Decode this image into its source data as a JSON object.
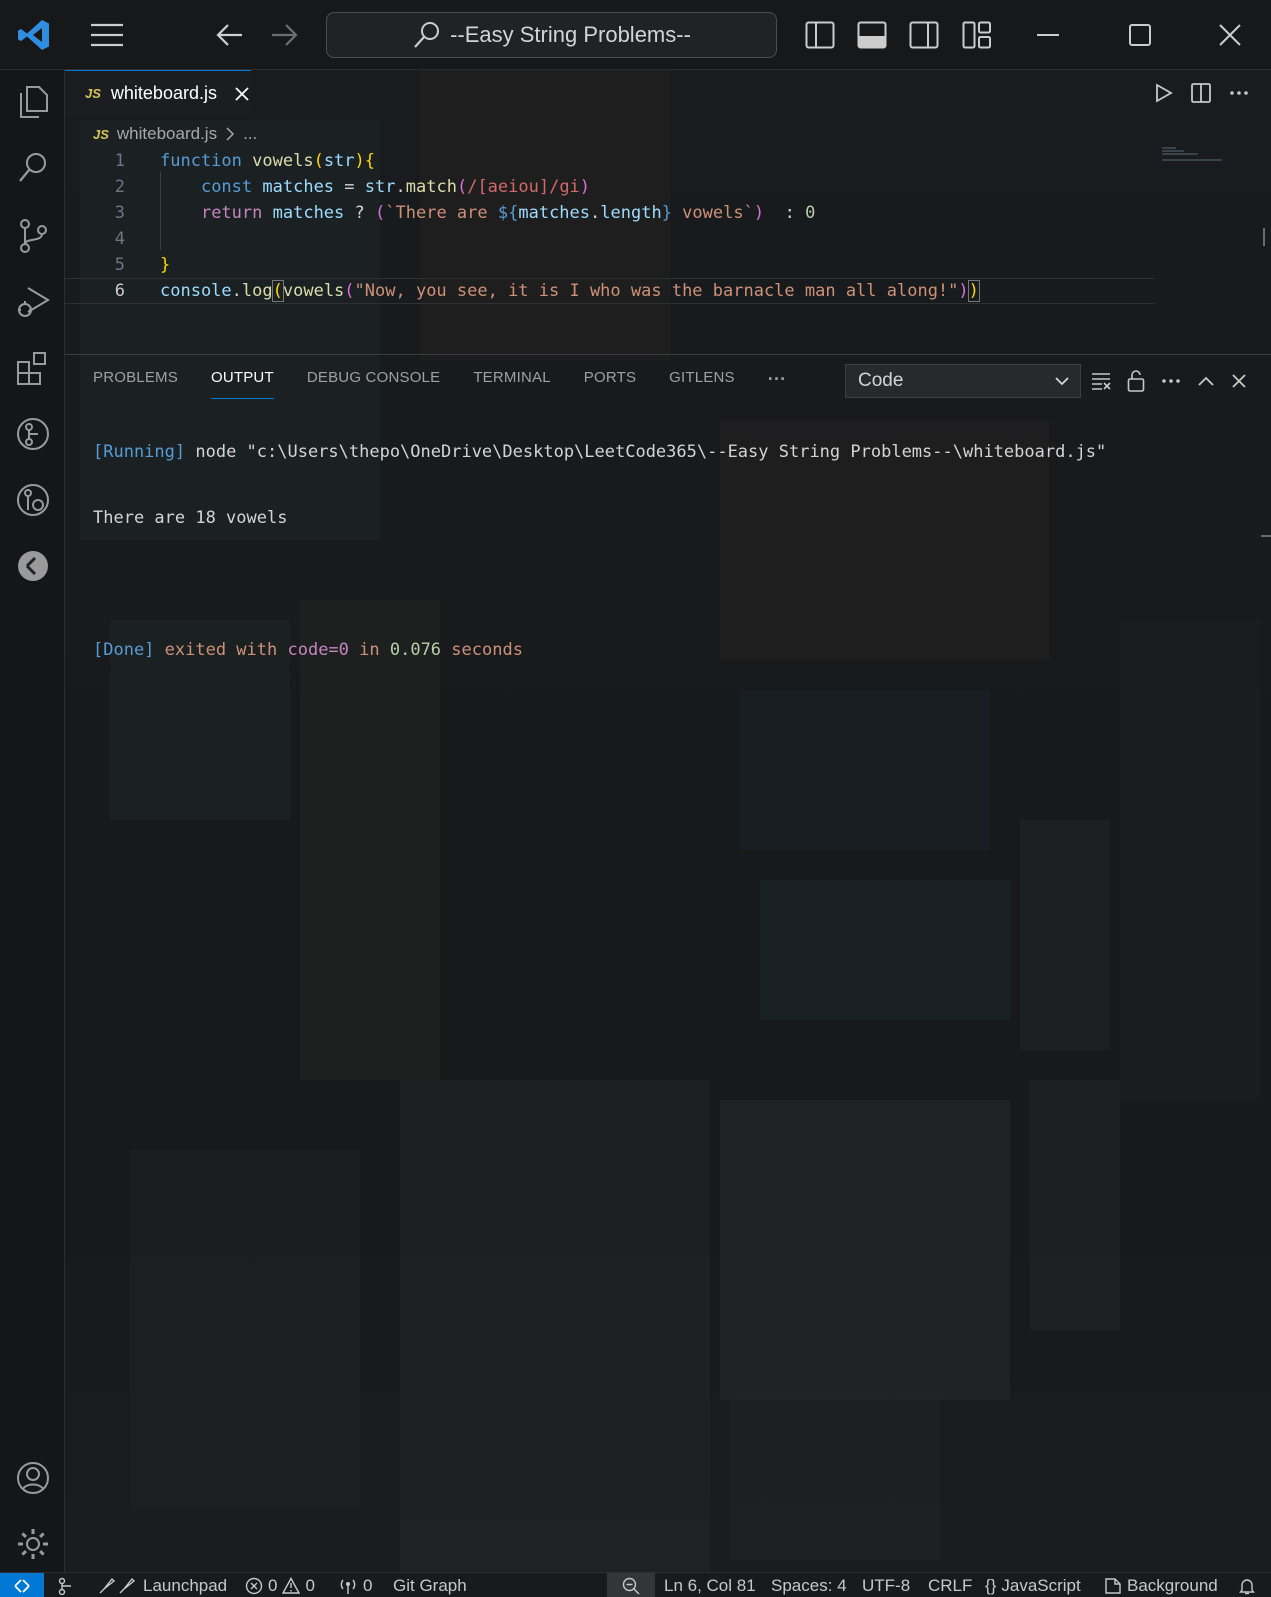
{
  "window": {
    "search_text": "--Easy String Problems--"
  },
  "tab": {
    "badge": "JS",
    "filename": "whiteboard.js"
  },
  "breadcrumb": {
    "badge": "JS",
    "file": "whiteboard.js",
    "more": "..."
  },
  "editor": {
    "line_numbers": [
      "1",
      "2",
      "3",
      "4",
      "5",
      "6"
    ],
    "current_line": 6,
    "lines": [
      "function vowels(str){",
      "    const matches = str.match(/[aeiou]/gi)",
      "    return matches ? (`There are ${matches.length} vowels`)  : 0",
      "",
      "}",
      "console.log(vowels(\"Now, you see, it is I who was the barnacle man all along!\"))"
    ]
  },
  "panel": {
    "tabs": [
      "PROBLEMS",
      "OUTPUT",
      "DEBUG CONSOLE",
      "TERMINAL",
      "PORTS",
      "GITLENS"
    ],
    "more": "···",
    "active_tab": "OUTPUT",
    "channel": "Code",
    "output": {
      "running_tag": "[Running]",
      "running_cmd": " node \"c:\\Users\\thepo\\OneDrive\\Desktop\\LeetCode365\\--Easy String Problems--\\whiteboard.js\"",
      "result": "There are 18 vowels",
      "done_tag": "[Done]",
      "done_exited": " exited with ",
      "done_code": "code=0",
      "done_in": " in ",
      "done_time": "0.076",
      "done_seconds": " seconds"
    }
  },
  "status": {
    "launchpad": "Launchpad",
    "errors": "0",
    "warnings": "0",
    "ports": "0",
    "git_graph": "Git Graph",
    "position": "Ln 6, Col 81",
    "spaces": "Spaces: 4",
    "encoding": "UTF-8",
    "eol": "CRLF",
    "language_braces": "{}",
    "language": "JavaScript",
    "background": "Background"
  },
  "colors": {
    "accent": "#0078d4",
    "keyword": "#569cd6",
    "function": "#dcdcaa",
    "variable": "#9cdcfe",
    "string": "#ce9178",
    "regex": "#d16969",
    "number": "#b5cea8",
    "control": "#c586c0"
  },
  "icons": [
    "vscode-logo-icon",
    "menu-icon",
    "back-arrow-icon",
    "forward-arrow-icon",
    "search-icon",
    "toggle-primary-sidebar-icon",
    "toggle-panel-icon",
    "toggle-secondary-sidebar-icon",
    "customize-layout-icon",
    "minimize-icon",
    "maximize-icon",
    "close-icon",
    "explorer-icon",
    "search-icon",
    "source-control-icon",
    "run-debug-icon",
    "extensions-icon",
    "git-lens-icon",
    "git-graph-icon",
    "remote-explorer-icon",
    "accounts-icon",
    "settings-gear-icon"
  ]
}
